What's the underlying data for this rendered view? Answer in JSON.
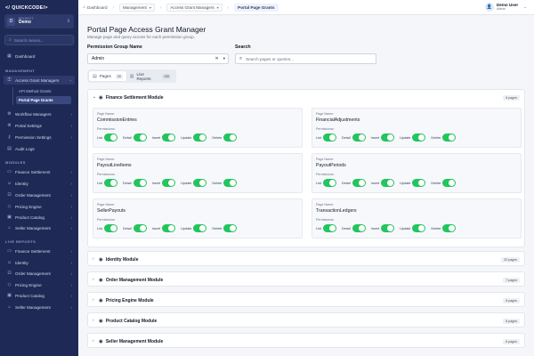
{
  "app": {
    "logo_text": "QUICKCODE",
    "project_label": "PROJECT",
    "project_value": "Demo",
    "project_badge": "D"
  },
  "sidebar": {
    "search_placeholder": "Search menus...",
    "dashboard": "Dashboard",
    "management_title": "MANAGEMENT",
    "management_items": [
      {
        "label": "Access Grant Managers",
        "icon": "key-icon"
      },
      {
        "label": "Workflow Managers",
        "icon": "workflow-icon"
      },
      {
        "label": "Portal Settings",
        "icon": "settings-icon"
      },
      {
        "label": "Permission Settings",
        "icon": "lock-icon"
      },
      {
        "label": "Audit Logs",
        "icon": "log-icon"
      }
    ],
    "sub_items": [
      "API Method Grants",
      "Portal Page Grants"
    ],
    "modules_title": "MODULES",
    "modules": [
      "Finance Settlement",
      "Identity",
      "Order Management",
      "Pricing Engine",
      "Product Catalog",
      "Seller Management"
    ],
    "live_title": "LIVE REPORTS",
    "live_reports": [
      "Finance Settlement",
      "Identity",
      "Order Management",
      "Pricing Engine",
      "Product Catalog",
      "Seller Management"
    ]
  },
  "header": {
    "home": "Dashboard",
    "crumb1": "Management",
    "crumb2": "Access Grant Managers",
    "current": "Portal Page Grants",
    "user_name": "Demo User",
    "user_role": "Admin"
  },
  "page": {
    "title": "Portal Page Access Grant Manager",
    "subtitle": "Manage page and query access for each permission group.",
    "group_label": "Permission Group Name",
    "group_value": "Admin",
    "search_label": "Search",
    "search_placeholder": "Search pages or queries...",
    "tabs": [
      {
        "label": "Pages",
        "count": "43"
      },
      {
        "label": "Live Reports",
        "count": "135"
      }
    ]
  },
  "labels": {
    "page_name": "Page Name:",
    "permissions": "Permissions:",
    "perms": [
      "List",
      "Detail",
      "Insert",
      "Update",
      "Delete"
    ]
  },
  "expanded_module": {
    "name": "Finance Settlement Module",
    "count": "6 pages",
    "pages": [
      "CommissionEntries",
      "FinancialAdjustments",
      "PayoutLineItems",
      "PayoutPeriods",
      "SellerPayouts",
      "TransactionLedgers"
    ]
  },
  "collapsed_modules": [
    {
      "name": "Identity Module",
      "count": "20 pages"
    },
    {
      "name": "Order Management Module",
      "count": "7 pages"
    },
    {
      "name": "Pricing Engine Module",
      "count": "6 pages"
    },
    {
      "name": "Product Catalog Module",
      "count": "8 pages"
    },
    {
      "name": "Seller Management Module",
      "count": "6 pages"
    }
  ],
  "colors": {
    "sidebar_bg": "#1e2a55",
    "toggle_on": "#22c55e",
    "accent": "#3a4880"
  }
}
